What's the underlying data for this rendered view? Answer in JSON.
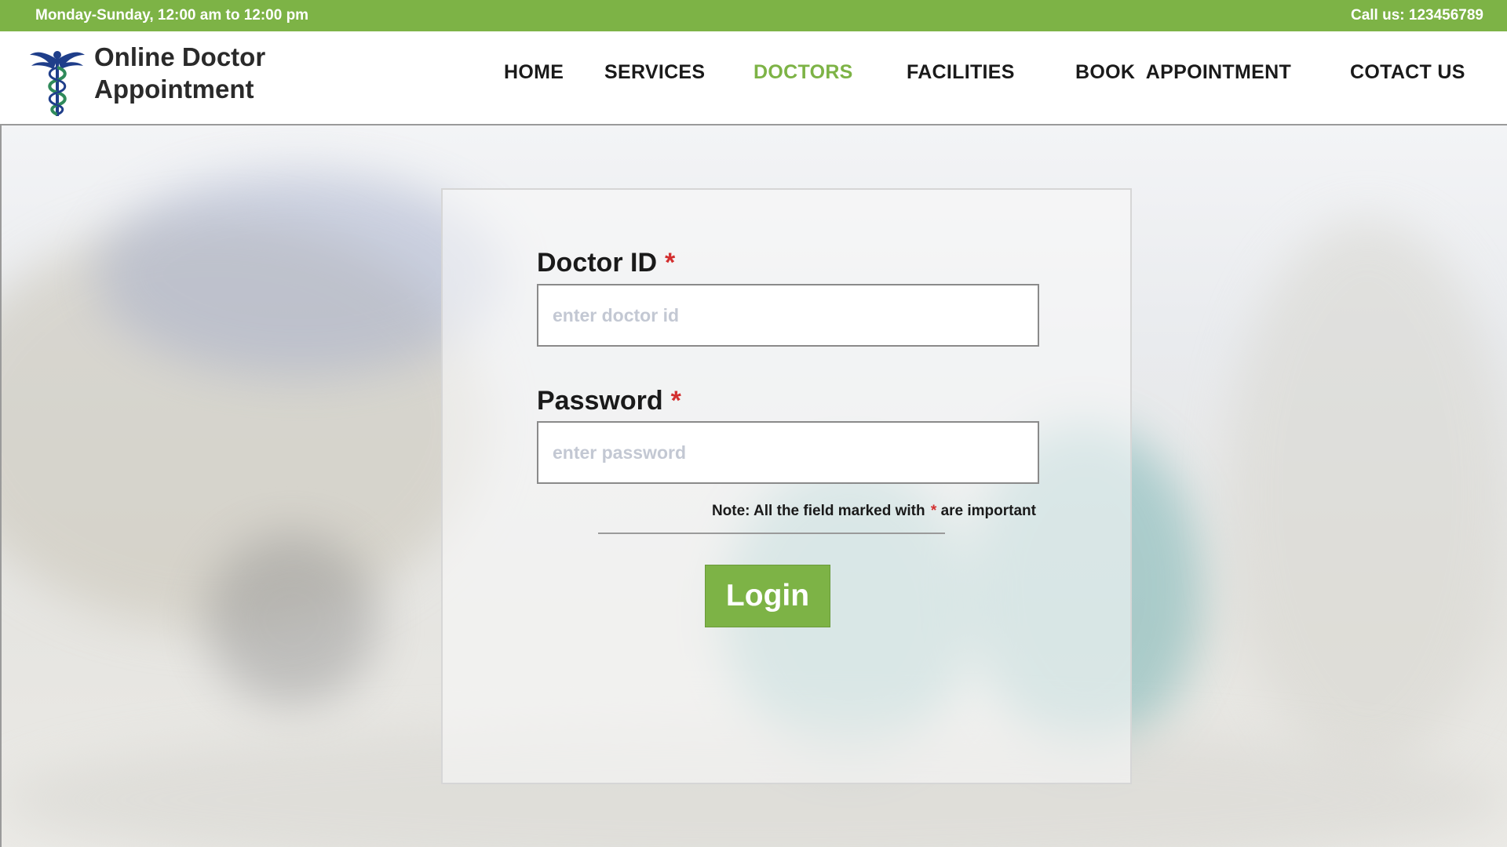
{
  "topbar": {
    "hours": "Monday-Sunday, 12:00 am to 12:00 pm",
    "phone": "Call us: 123456789"
  },
  "header": {
    "brand_line1": "Online Doctor",
    "brand_line2": "Appointment",
    "logo_icon": "caduceus-icon"
  },
  "nav": {
    "items": [
      {
        "label": "HOME"
      },
      {
        "label": "SERVICES"
      },
      {
        "label": "DOCTORS"
      },
      {
        "label": "FACILITIES"
      },
      {
        "label": "BOOK  APPOINTMENT"
      },
      {
        "label": "COTACT US"
      }
    ],
    "active": "DOCTORS"
  },
  "login": {
    "doctor_id_label": "Doctor ID",
    "doctor_id_placeholder": "enter doctor id",
    "doctor_id_value": "",
    "password_label": "Password",
    "password_placeholder": "enter password",
    "password_value": "",
    "required_mark": "*",
    "note_prefix": "Note: All the field marked with",
    "note_suffix": "are important",
    "button_label": "Login"
  },
  "colors": {
    "accent": "#7db346",
    "required": "#d32f2f",
    "text": "#1a1a1a"
  }
}
